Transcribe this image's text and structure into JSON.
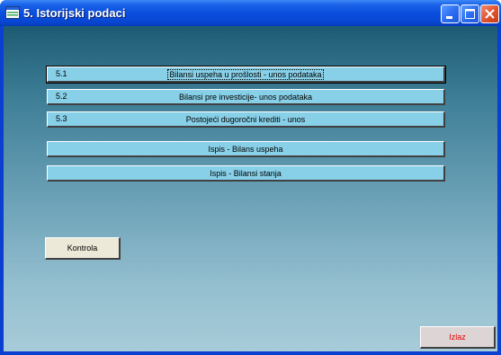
{
  "window": {
    "title": "5. Istorijski podaci"
  },
  "menu": {
    "items": [
      {
        "number": "5.1",
        "label": "Bilansi uspeha u prošlosti - unos podataka"
      },
      {
        "number": "5.2",
        "label": "Bilansi pre investicije- unos podataka"
      },
      {
        "number": "5.3",
        "label": "Postojeći dugoročni krediti - unos"
      },
      {
        "number": "",
        "label": "Ispis - Bilans uspeha"
      },
      {
        "number": "",
        "label": "Ispis - Bilansi stanja"
      }
    ]
  },
  "buttons": {
    "kontrola": "Kontrola",
    "izlaz": "Izlaz"
  },
  "colors": {
    "title_bar": "#0a4fde",
    "menu_button": "#88d0e8",
    "izlaz_text": "#e00000"
  }
}
